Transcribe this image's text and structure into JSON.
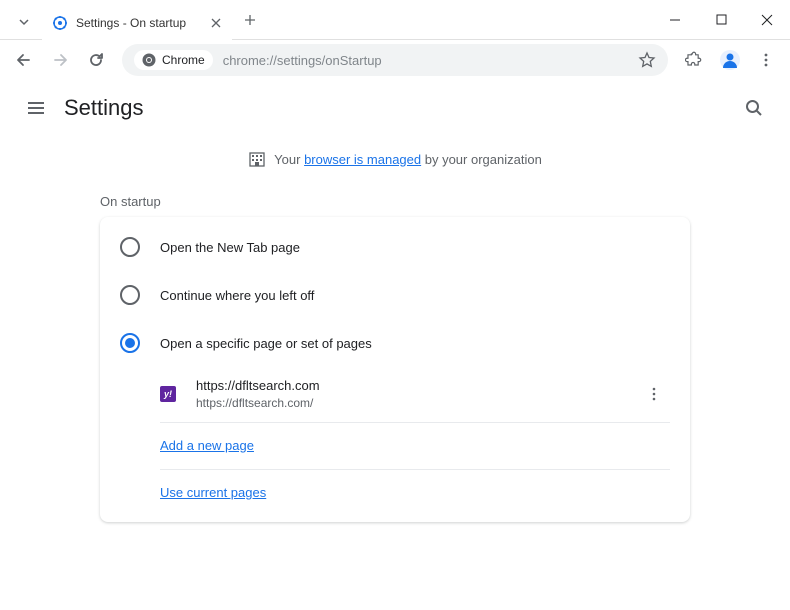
{
  "window": {
    "tab_title": "Settings - On startup"
  },
  "toolbar": {
    "chrome_label": "Chrome",
    "url": "chrome://settings/onStartup"
  },
  "header": {
    "title": "Settings"
  },
  "managed": {
    "prefix": "Your ",
    "link": "browser is managed",
    "suffix": " by your organization"
  },
  "section": {
    "title": "On startup"
  },
  "options": [
    {
      "label": "Open the New Tab page",
      "selected": false
    },
    {
      "label": "Continue where you left off",
      "selected": false
    },
    {
      "label": "Open a specific page or set of pages",
      "selected": true
    }
  ],
  "pages": [
    {
      "title": "https://dfltsearch.com",
      "url": "https://dfltsearch.com/"
    }
  ],
  "actions": {
    "add_page": "Add a new page",
    "use_current": "Use current pages"
  }
}
